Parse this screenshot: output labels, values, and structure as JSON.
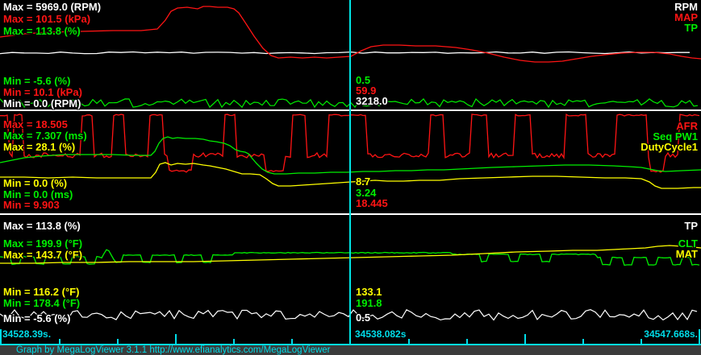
{
  "colors": {
    "white": "#ffffff",
    "red": "#ff1414",
    "green": "#00ee00",
    "yellow": "#ffff00",
    "cursor": "#00e5e5",
    "cyan_text": "#00dce8",
    "separator": "#ffffff",
    "background": "#000000",
    "statusbar_bg": "#3b3b3b"
  },
  "panels": [
    {
      "name": "rpm-map-tp",
      "max_labels": [
        {
          "text": "Max = 5969.0 (RPM)",
          "color": "#ffffff"
        },
        {
          "text": "Max = 101.5 (kPa)",
          "color": "#ff1414"
        },
        {
          "text": "Max = 113.8 (%)",
          "color": "#00ee00"
        }
      ],
      "min_labels": [
        {
          "text": "Min = -5.6 (%)",
          "color": "#00ee00"
        },
        {
          "text": "Min = 10.1 (kPa)",
          "color": "#ff1414"
        },
        {
          "text": "Min = 0.0 (RPM)",
          "color": "#ffffff"
        }
      ],
      "legend": [
        {
          "label": "RPM",
          "color": "#ffffff"
        },
        {
          "label": "MAP",
          "color": "#ff1414"
        },
        {
          "label": "TP",
          "color": "#00ee00"
        }
      ],
      "cursor_values": [
        {
          "value": "0.5",
          "color": "#00ee00"
        },
        {
          "value": "59.9",
          "color": "#ff1414"
        },
        {
          "value": "3218.0",
          "color": "#ffffff"
        }
      ]
    },
    {
      "name": "afr-pw-duty",
      "max_labels": [
        {
          "text": "Max = 18.505",
          "color": "#ff1414"
        },
        {
          "text": "Max = 7.307 (ms)",
          "color": "#00ee00"
        },
        {
          "text": "Max = 28.1 (%)",
          "color": "#ffff00"
        }
      ],
      "min_labels": [
        {
          "text": "Min = 0.0 (%)",
          "color": "#ffff00"
        },
        {
          "text": "Min = 0.0 (ms)",
          "color": "#00ee00"
        },
        {
          "text": "Min = 9.903",
          "color": "#ff1414"
        }
      ],
      "legend": [
        {
          "label": "AFR",
          "color": "#ff1414"
        },
        {
          "label": "Seq PW1",
          "color": "#00ee00"
        },
        {
          "label": "DutyCycle1",
          "color": "#ffff00"
        }
      ],
      "cursor_values": [
        {
          "value": "8.7",
          "color": "#ffff00"
        },
        {
          "value": "3.24",
          "color": "#00ee00"
        },
        {
          "value": "18.445",
          "color": "#ff1414"
        }
      ]
    },
    {
      "name": "tp-clt-mat",
      "max_labels": [
        {
          "text": "Max = 113.8 (%)",
          "color": "#ffffff"
        },
        {
          "text": "Max = 199.9 (°F)",
          "color": "#00ee00"
        },
        {
          "text": "Max = 143.7 (°F)",
          "color": "#ffff00"
        }
      ],
      "min_labels": [
        {
          "text": "Min = 116.2 (°F)",
          "color": "#ffff00"
        },
        {
          "text": "Min = 178.4 (°F)",
          "color": "#00ee00"
        },
        {
          "text": "Min = -5.6 (%)",
          "color": "#ffffff"
        }
      ],
      "legend": [
        {
          "label": "TP",
          "color": "#ffffff"
        },
        {
          "label": "CLT",
          "color": "#00ee00"
        },
        {
          "label": "MAT",
          "color": "#ffff00"
        }
      ],
      "cursor_values": [
        {
          "value": "133.1",
          "color": "#ffff00"
        },
        {
          "value": "191.8",
          "color": "#00ee00"
        },
        {
          "value": "0.5",
          "color": "#ffffff"
        }
      ]
    }
  ],
  "time_axis": {
    "start": "34528.39s.",
    "cursor": "34538.082s",
    "end": "34547.668s."
  },
  "status_bar": {
    "text": "Graph by MegaLogViewer 3.1.1 http://www.efianalytics.com/MegaLogViewer"
  }
}
